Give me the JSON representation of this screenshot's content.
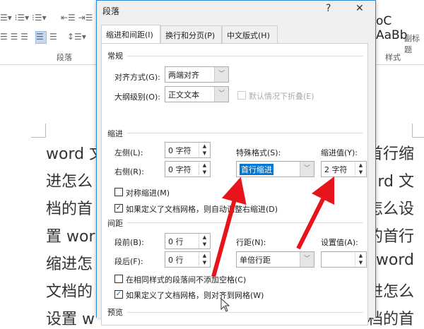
{
  "ribbon": {
    "group_paragraph": "段落",
    "group_styles": "样式",
    "style_preview": "oC  AaBb",
    "style_name": "副标题"
  },
  "document": {
    "left": [
      "word 文",
      "进怎么",
      "档的首",
      "置 wor",
      "缩进怎",
      "文档的",
      "设置 w"
    ],
    "right": [
      "首行缩",
      "rd 文",
      "怎么设",
      "的首行",
      "word",
      "进怎么",
      "档的首"
    ]
  },
  "dialog": {
    "title": "段落",
    "help": "?",
    "close": "✕",
    "tabs": [
      "缩进和间距(I)",
      "换行和分页(P)",
      "中文版式(H)"
    ],
    "general": {
      "heading": "常规",
      "align_label": "对齐方式(G):",
      "align_value": "两端对齐",
      "outline_label": "大纲级别(O):",
      "outline_value": "正文文本",
      "collapse_label": "默认情况下折叠(E)"
    },
    "indent": {
      "heading": "缩进",
      "left_label": "左侧(L):",
      "left_value": "0 字符",
      "right_label": "右侧(R):",
      "right_value": "0 字符",
      "special_label": "特殊格式(S):",
      "special_value": "首行缩进",
      "by_label": "缩进值(Y):",
      "by_value": "2 字符",
      "mirror_label": "对称缩进(M)",
      "mirror_checked": false,
      "auto_label": "如果定义了文档网格，则自动调整右缩进(D)",
      "auto_checked": true
    },
    "spacing": {
      "heading": "间距",
      "before_label": "段前(B):",
      "before_value": "0 行",
      "after_label": "段后(F):",
      "after_value": "0 行",
      "line_label": "行距(N):",
      "line_value": "单倍行距",
      "at_label": "设置值(A):",
      "at_value": "",
      "nospace_label": "在相同样式的段落间不添加空格(C)",
      "nospace_checked": false,
      "grid_label": "如果定义了文档网格，则对齐到网格(W)",
      "grid_checked": true
    },
    "preview": {
      "heading": "预览"
    }
  },
  "colors": {
    "arrow": "#e8141b",
    "accent": "#0078d7"
  }
}
